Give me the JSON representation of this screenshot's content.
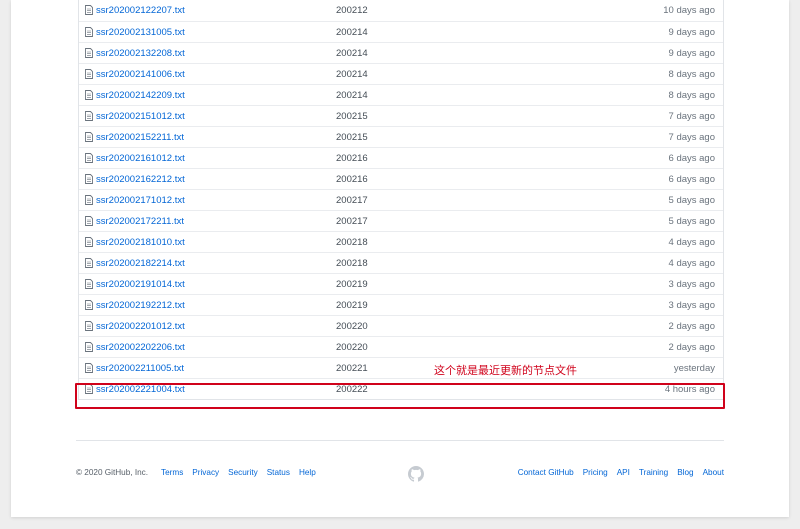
{
  "files": [
    {
      "name": "ssr202002122207.txt",
      "message": "200212",
      "age": "10 days ago"
    },
    {
      "name": "ssr202002131005.txt",
      "message": "200214",
      "age": "9 days ago"
    },
    {
      "name": "ssr202002132208.txt",
      "message": "200214",
      "age": "9 days ago"
    },
    {
      "name": "ssr202002141006.txt",
      "message": "200214",
      "age": "8 days ago"
    },
    {
      "name": "ssr202002142209.txt",
      "message": "200214",
      "age": "8 days ago"
    },
    {
      "name": "ssr202002151012.txt",
      "message": "200215",
      "age": "7 days ago"
    },
    {
      "name": "ssr202002152211.txt",
      "message": "200215",
      "age": "7 days ago"
    },
    {
      "name": "ssr202002161012.txt",
      "message": "200216",
      "age": "6 days ago"
    },
    {
      "name": "ssr202002162212.txt",
      "message": "200216",
      "age": "6 days ago"
    },
    {
      "name": "ssr202002171012.txt",
      "message": "200217",
      "age": "5 days ago"
    },
    {
      "name": "ssr202002172211.txt",
      "message": "200217",
      "age": "5 days ago"
    },
    {
      "name": "ssr202002181010.txt",
      "message": "200218",
      "age": "4 days ago"
    },
    {
      "name": "ssr202002182214.txt",
      "message": "200218",
      "age": "4 days ago"
    },
    {
      "name": "ssr202002191014.txt",
      "message": "200219",
      "age": "3 days ago"
    },
    {
      "name": "ssr202002192212.txt",
      "message": "200219",
      "age": "3 days ago"
    },
    {
      "name": "ssr202002201012.txt",
      "message": "200220",
      "age": "2 days ago"
    },
    {
      "name": "ssr202002202206.txt",
      "message": "200220",
      "age": "2 days ago"
    },
    {
      "name": "ssr202002211005.txt",
      "message": "200221",
      "age": "yesterday"
    },
    {
      "name": "ssr202002221004.txt",
      "message": "200222",
      "age": "4 hours ago"
    }
  ],
  "annotation": {
    "text": "这个就是最近更新的节点文件",
    "color": "#d0021b"
  },
  "footer": {
    "copyright": "© 2020 GitHub, Inc.",
    "left_links": [
      "Terms",
      "Privacy",
      "Security",
      "Status",
      "Help"
    ],
    "right_links": [
      "Contact GitHub",
      "Pricing",
      "API",
      "Training",
      "Blog",
      "About"
    ]
  },
  "colors": {
    "link": "#0366d6",
    "muted": "#6a737d",
    "highlight": "#d0021b"
  }
}
